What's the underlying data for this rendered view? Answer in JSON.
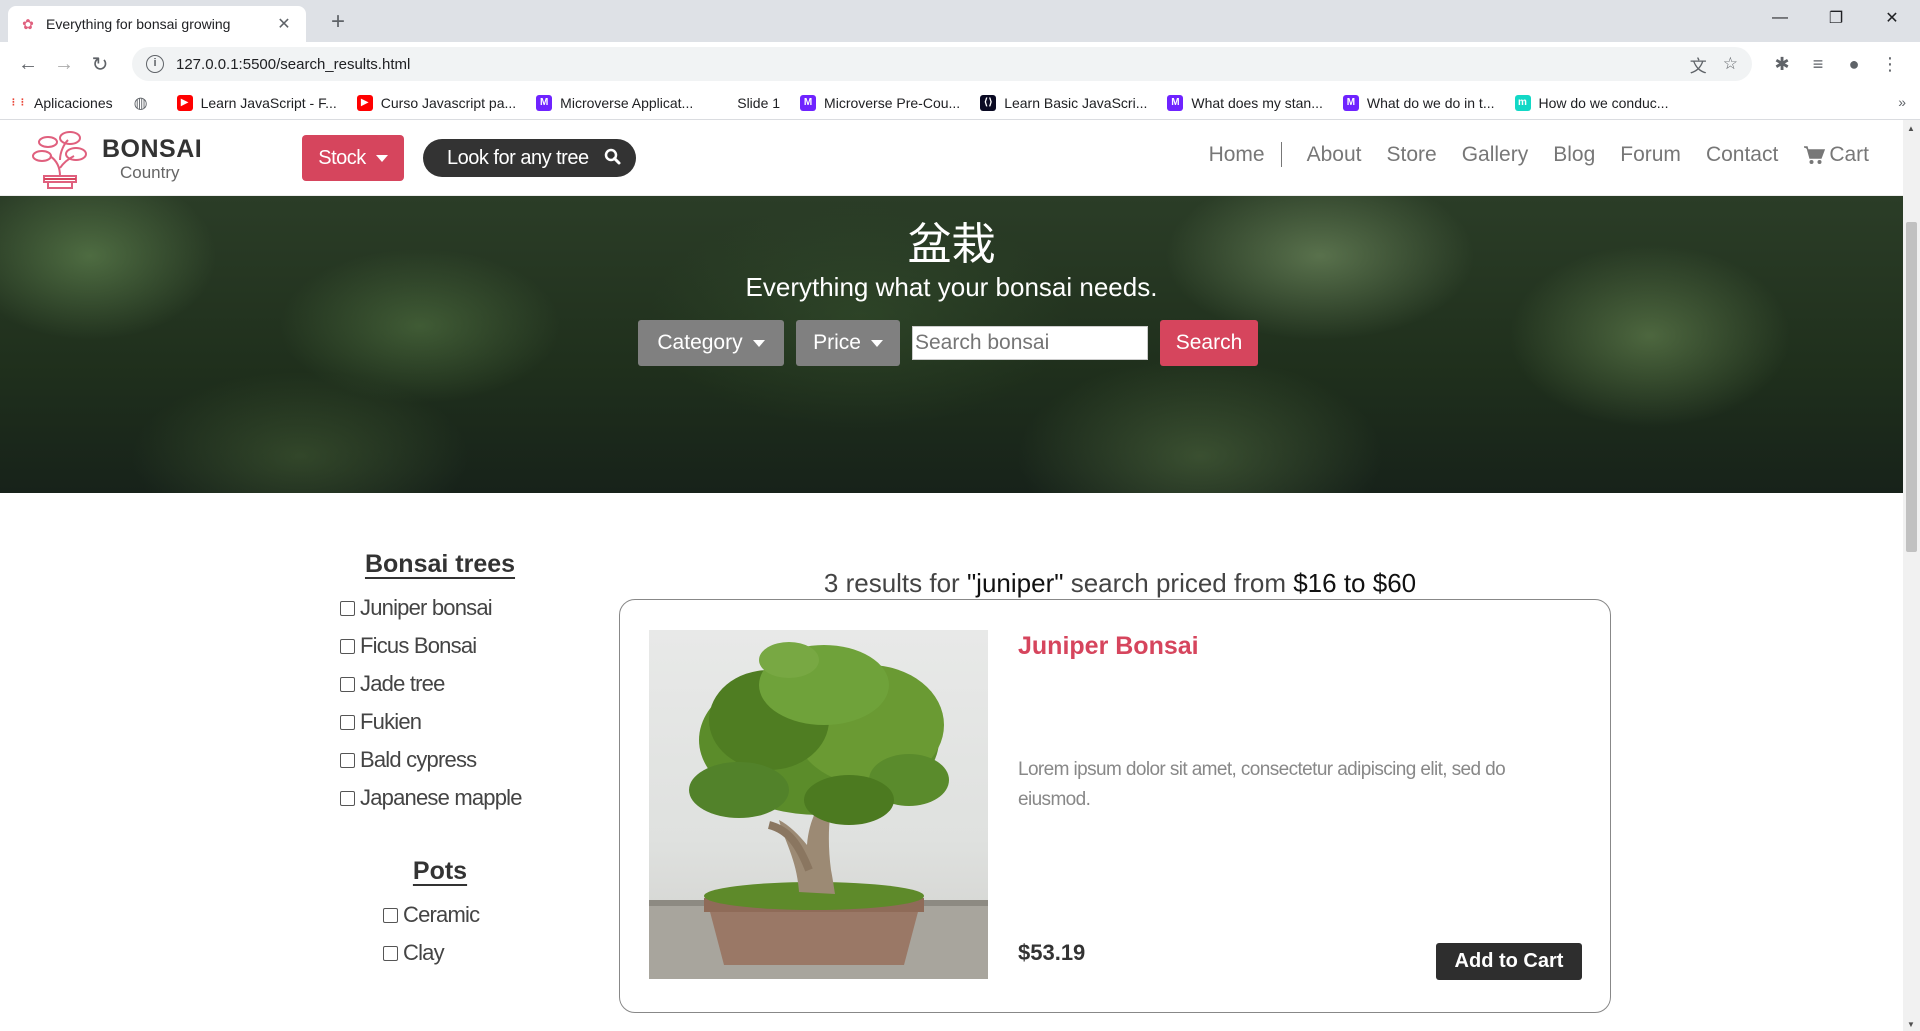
{
  "browser": {
    "tab_title": "Everything for bonsai growing",
    "url": "127.0.0.1:5500/search_results.html",
    "bookmarks": [
      {
        "label": "Aplicaciones",
        "icon": "apps-grid-icon",
        "color": "#4285f4"
      },
      {
        "label": "",
        "icon": "globe-icon",
        "color": "#5f6368"
      },
      {
        "label": "Learn JavaScript - F...",
        "icon": "youtube-icon",
        "color": "#ff0000"
      },
      {
        "label": "Curso Javascript pa...",
        "icon": "youtube-icon",
        "color": "#ff0000"
      },
      {
        "label": "Microverse Applicat...",
        "icon": "microverse-icon",
        "color": "#6f23ff"
      },
      {
        "label": "Slide 1",
        "icon": "blank-icon",
        "color": "#ffffff"
      },
      {
        "label": "Microverse Pre-Cou...",
        "icon": "microverse-icon",
        "color": "#6f23ff"
      },
      {
        "label": "Learn Basic JavaScri...",
        "icon": "freecodecamp-icon",
        "color": "#0a0a23"
      },
      {
        "label": "What does my stan...",
        "icon": "microverse-icon",
        "color": "#6f23ff"
      },
      {
        "label": "What do we do in t...",
        "icon": "microverse-icon",
        "color": "#6f23ff"
      },
      {
        "label": "How do we conduc...",
        "icon": "m-icon",
        "color": "#12d8c6"
      }
    ],
    "more_bookmarks": "»"
  },
  "site": {
    "brand_name": "BONSAI",
    "brand_sub": "Country",
    "stock_label": "Stock",
    "look_label": "Look for any tree",
    "menu": [
      "Home",
      "About",
      "Store",
      "Gallery",
      "Blog",
      "Forum",
      "Contact"
    ],
    "cart_label": "Cart",
    "accent": "#d6455d"
  },
  "hero": {
    "title": "盆栽",
    "subtitle": "Everything what your bonsai needs.",
    "category_label": "Category",
    "price_label": "Price",
    "search_placeholder": "Search bonsai",
    "search_label": "Search"
  },
  "filters": {
    "trees_heading": "Bonsai trees",
    "trees": [
      "Juniper bonsai",
      "Ficus Bonsai",
      "Jade tree",
      "Fukien",
      "Bald cypress",
      "Japanese mapple"
    ],
    "pots_heading": "Pots",
    "pots": [
      "Ceramic",
      "Clay"
    ]
  },
  "results": {
    "count_text": "3 results for ",
    "query": "\"juniper\"",
    "mid_text": " search priced from ",
    "price_range": "$16 to $60"
  },
  "product": {
    "name": "Juniper Bonsai",
    "description": "Lorem ipsum dolor sit amet, consectetur adipiscing elit, sed do eiusmod.",
    "price": "$53.19",
    "add_label": "Add to Cart"
  }
}
